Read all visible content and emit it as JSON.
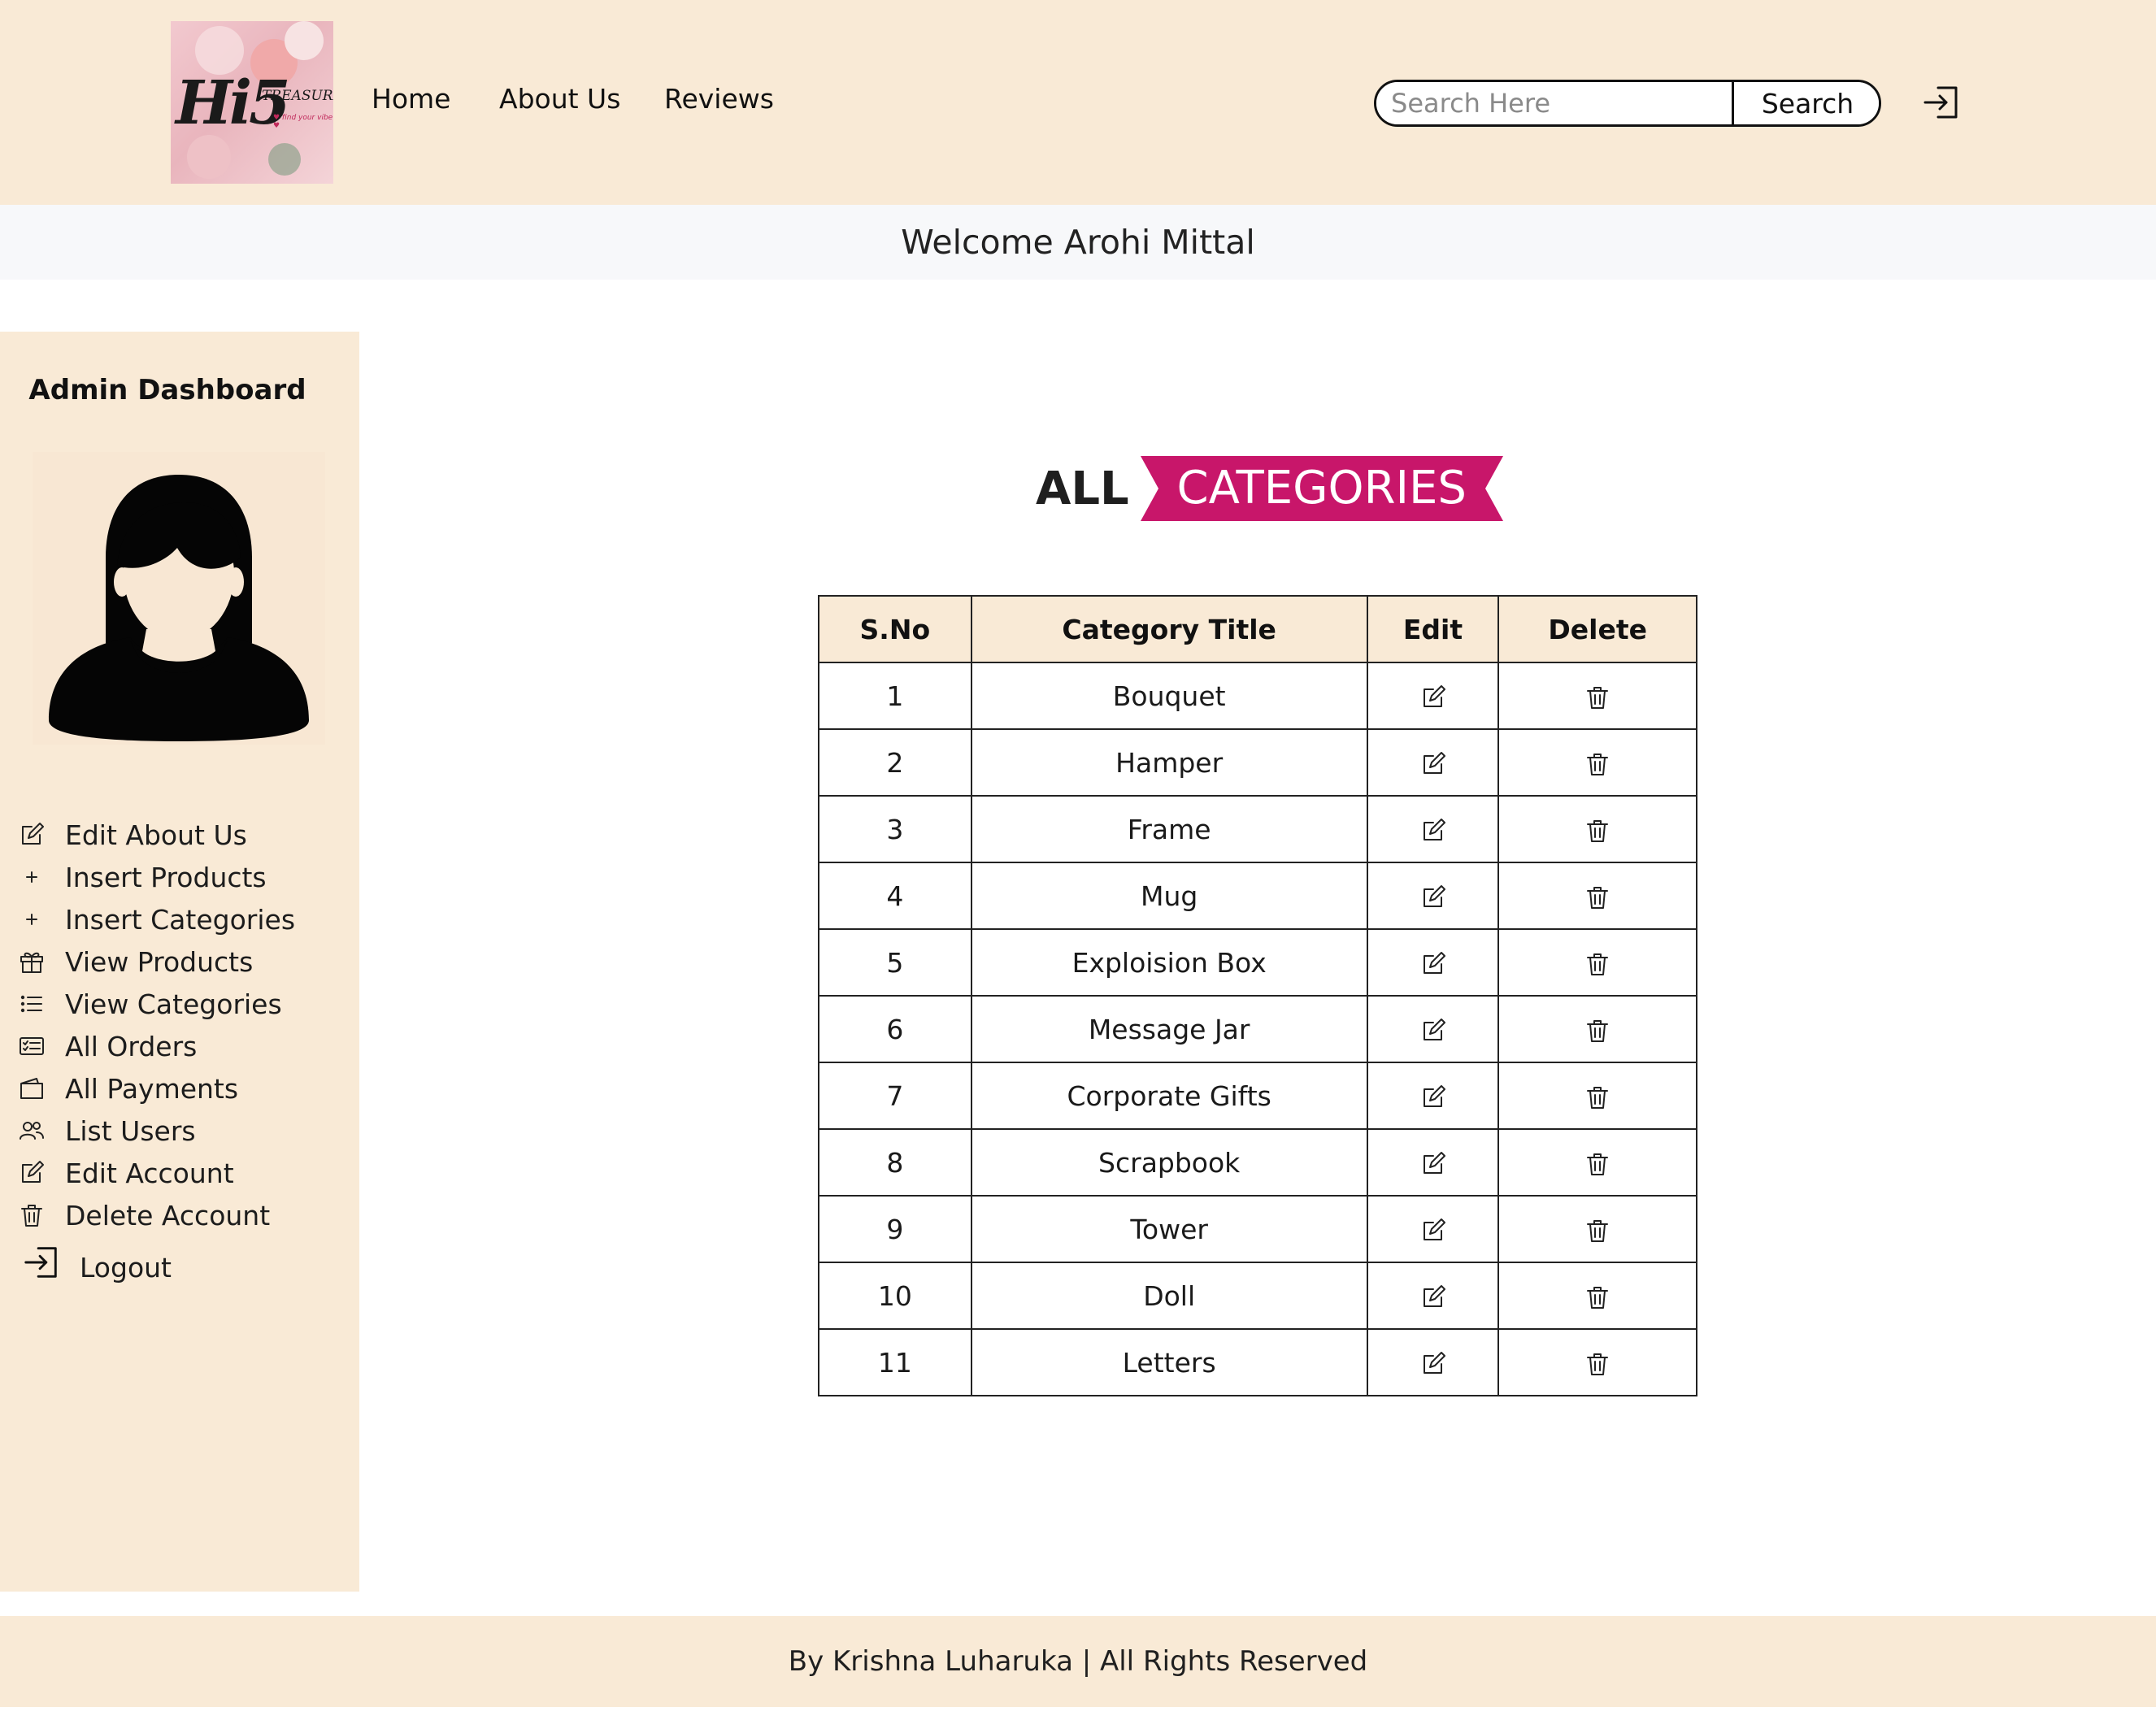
{
  "header": {
    "logo": {
      "brand": "Hi5",
      "brand_sub": "TREASURES",
      "tagline": "♥ find your vibe ♥"
    },
    "nav": [
      "Home",
      "About Us",
      "Reviews"
    ],
    "search": {
      "placeholder": "Search Here",
      "value": "",
      "button_label": "Search"
    },
    "login_icon": "login-icon"
  },
  "welcome": "Welcome Arohi Mittal",
  "sidebar": {
    "title": "Admin Dashboard",
    "avatar_icon": "user-female-avatar",
    "items": [
      {
        "label": "Edit About Us",
        "icon": "edit-icon"
      },
      {
        "label": "Insert Products",
        "icon": "plus-icon"
      },
      {
        "label": "Insert Categories",
        "icon": "plus-icon"
      },
      {
        "label": "View Products",
        "icon": "gift-icon"
      },
      {
        "label": "View Categories",
        "icon": "list-icon"
      },
      {
        "label": "All Orders",
        "icon": "orders-icon"
      },
      {
        "label": "All Payments",
        "icon": "wallet-icon"
      },
      {
        "label": "List Users",
        "icon": "users-icon"
      },
      {
        "label": "Edit Account",
        "icon": "edit-icon"
      },
      {
        "label": "Delete Account",
        "icon": "trash-icon"
      },
      {
        "label": "Logout",
        "icon": "logout-icon"
      }
    ]
  },
  "main": {
    "heading_prefix": "ALL",
    "heading_highlight": "CATEGORIES",
    "accent_color": "#c8166a",
    "table": {
      "headers": [
        "S.No",
        "Category Title",
        "Edit",
        "Delete"
      ],
      "rows": [
        {
          "sno": "1",
          "title": "Bouquet"
        },
        {
          "sno": "2",
          "title": "Hamper"
        },
        {
          "sno": "3",
          "title": "Frame"
        },
        {
          "sno": "4",
          "title": "Mug"
        },
        {
          "sno": "5",
          "title": "Exploision Box"
        },
        {
          "sno": "6",
          "title": "Message Jar"
        },
        {
          "sno": "7",
          "title": "Corporate Gifts"
        },
        {
          "sno": "8",
          "title": "Scrapbook"
        },
        {
          "sno": "9",
          "title": "Tower"
        },
        {
          "sno": "10",
          "title": "Doll"
        },
        {
          "sno": "11",
          "title": "Letters"
        }
      ]
    }
  },
  "footer": "By Krishna Luharuka | All Rights Reserved",
  "colors": {
    "header_bg": "#f9ead6",
    "welcome_bg": "#f7f8fa",
    "accent": "#c8166a"
  }
}
